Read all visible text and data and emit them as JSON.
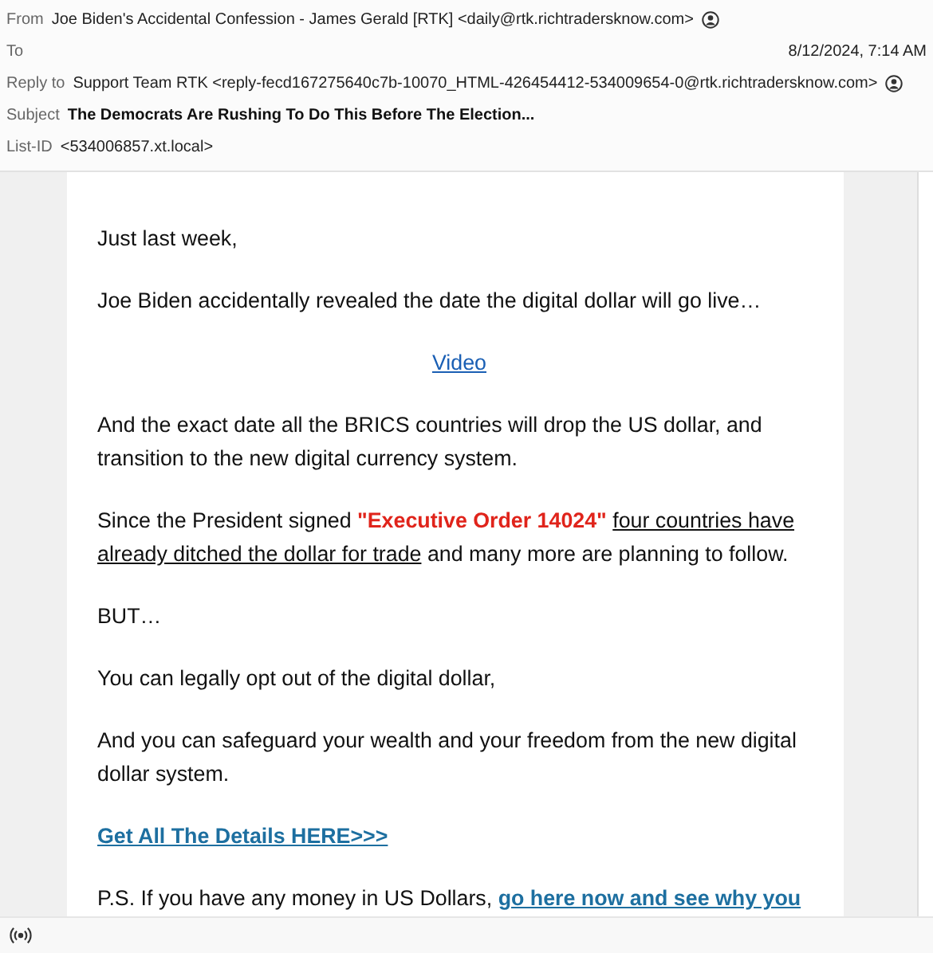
{
  "header": {
    "fields": [
      {
        "label": "From",
        "value": "Joe Biden's Accidental Confession - James Gerald [RTK] <daily@rtk.richtradersknow.com>",
        "kind": "contact"
      },
      {
        "label": "To",
        "date": "8/12/2024, 7:14 AM",
        "kind": "date"
      },
      {
        "label": "Reply to",
        "value": "Support Team RTK <reply-fecd167275640c7b-10070_HTML-426454412-534009654-0@rtk.richtradersknow.com>",
        "kind": "contact"
      },
      {
        "label": "Subject",
        "value": "The Democrats Are Rushing To Do This Before The Election...",
        "kind": "subject"
      },
      {
        "label": "List-ID",
        "value": "<534006857.xt.local>",
        "kind": "plain"
      }
    ]
  },
  "body": {
    "paragraphs": [
      {
        "kind": "text",
        "parts": [
          {
            "kind": "plain",
            "text": "Just last week,"
          }
        ]
      },
      {
        "kind": "text",
        "parts": [
          {
            "kind": "plain",
            "text": "Joe Biden accidentally revealed the date the digital dollar will go live…"
          }
        ]
      },
      {
        "kind": "center-link",
        "parts": [
          {
            "kind": "link",
            "text": "Video"
          }
        ]
      },
      {
        "kind": "text",
        "parts": [
          {
            "kind": "plain",
            "text": "And the exact date all the BRICS countries will drop the US dollar, and transition to the new digital currency system."
          }
        ]
      },
      {
        "kind": "text",
        "parts": [
          {
            "kind": "plain",
            "text": "Since the President signed "
          },
          {
            "kind": "emphasis",
            "text": "\"Executive Order 14024\" "
          },
          {
            "kind": "underline",
            "text": "four countries have already ditched the dollar for trade"
          },
          {
            "kind": "plain",
            "text": " and many more are planning to follow."
          }
        ]
      },
      {
        "kind": "text",
        "parts": [
          {
            "kind": "plain",
            "text": "BUT…"
          }
        ]
      },
      {
        "kind": "text",
        "parts": [
          {
            "kind": "plain",
            "text": "You can legally opt out of the digital dollar,"
          }
        ]
      },
      {
        "kind": "text",
        "parts": [
          {
            "kind": "plain",
            "text": "And you can safeguard your wealth and your freedom from the new digital dollar system."
          }
        ]
      },
      {
        "kind": "bold-link",
        "parts": [
          {
            "kind": "bold-link",
            "text": "Get All The Details HERE>>>"
          }
        ]
      },
      {
        "kind": "text",
        "parts": [
          {
            "kind": "plain",
            "text": "P.S. If you have any money in US Dollars, "
          },
          {
            "kind": "bold-link",
            "text": "go here now and see why you"
          }
        ]
      }
    ]
  }
}
